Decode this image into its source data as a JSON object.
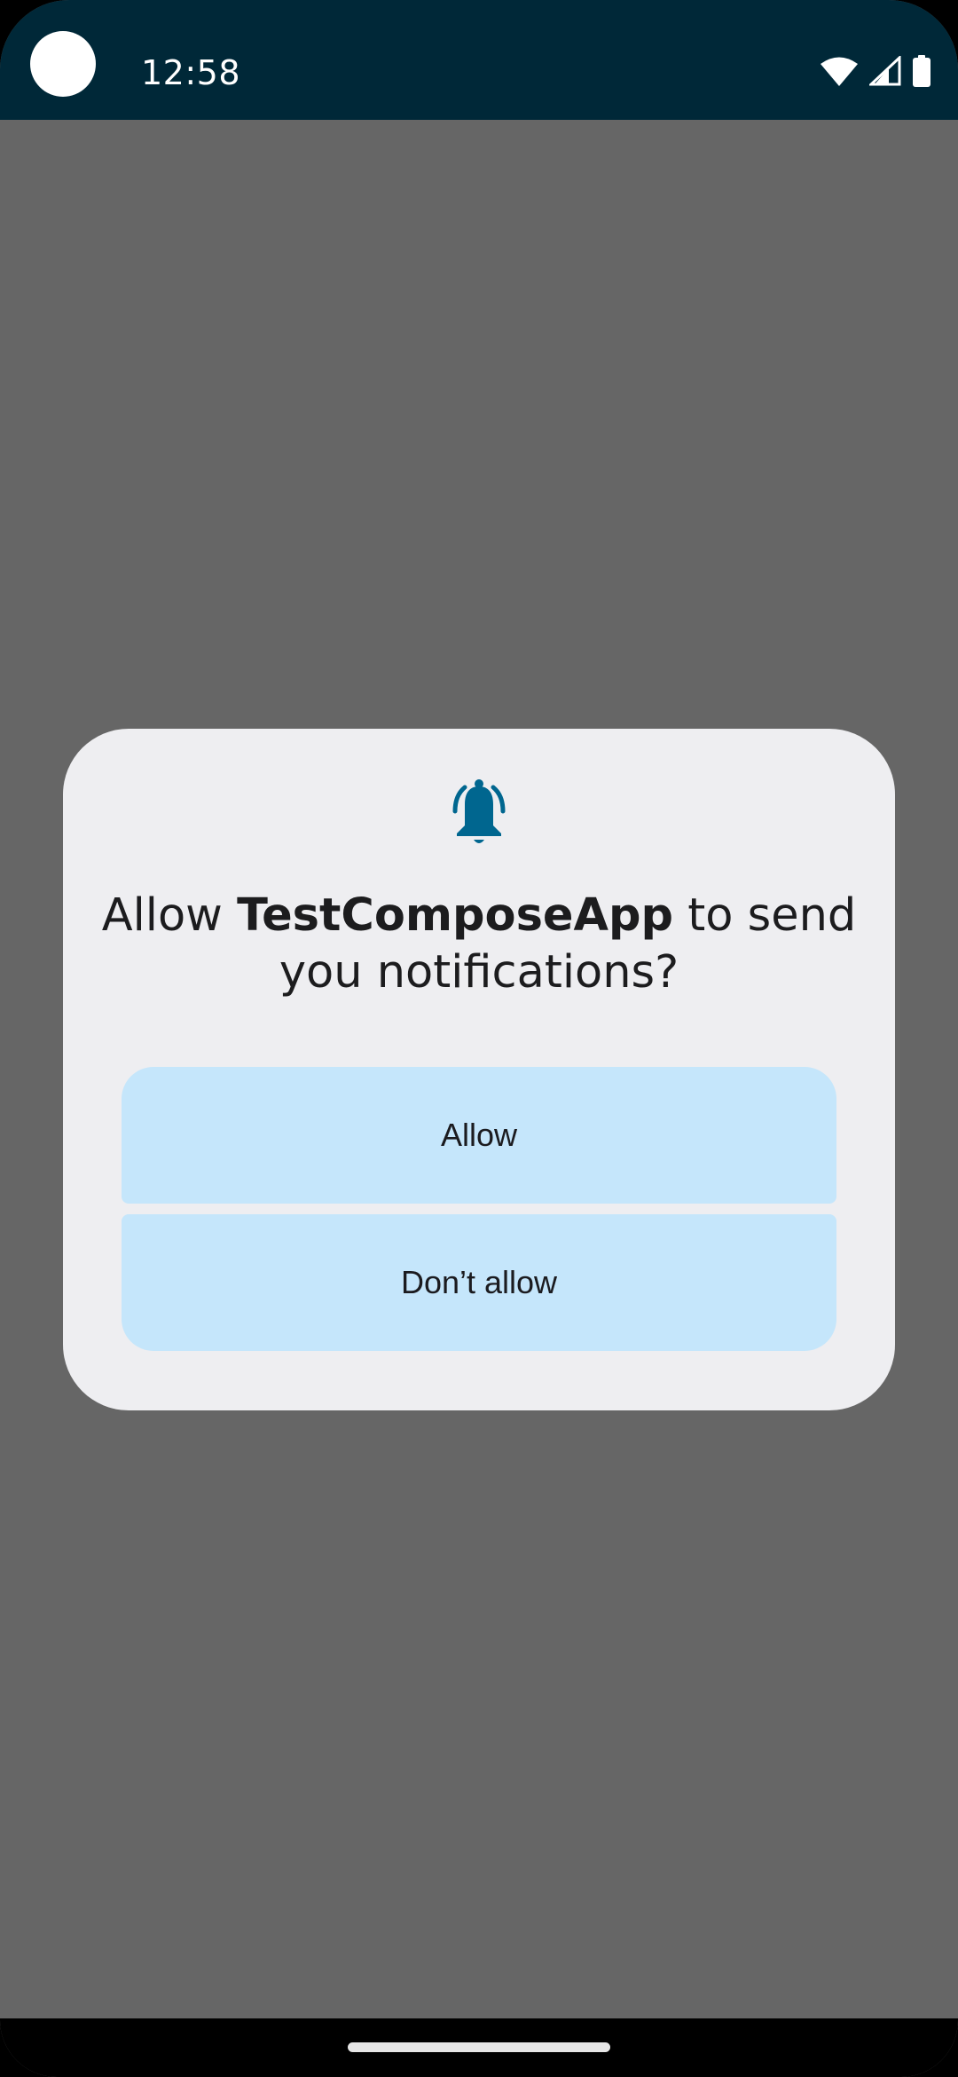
{
  "status_bar": {
    "time": "12:58",
    "icons": [
      "wifi-icon",
      "cellular-signal-icon",
      "battery-icon"
    ]
  },
  "dialog": {
    "icon": "notification-bell-icon",
    "prompt_prefix": "Allow ",
    "app_name": "TestComposeApp",
    "prompt_suffix": " to send you notifications?",
    "allow_label": "Allow",
    "deny_label": "Don’t allow"
  },
  "colors": {
    "status_bar_bg": "#002838",
    "scrim": "#666666",
    "dialog_bg": "#eeeef1",
    "button_bg": "#c5e6fb",
    "bell_icon": "#00668f",
    "text": "#1c1c1e"
  }
}
